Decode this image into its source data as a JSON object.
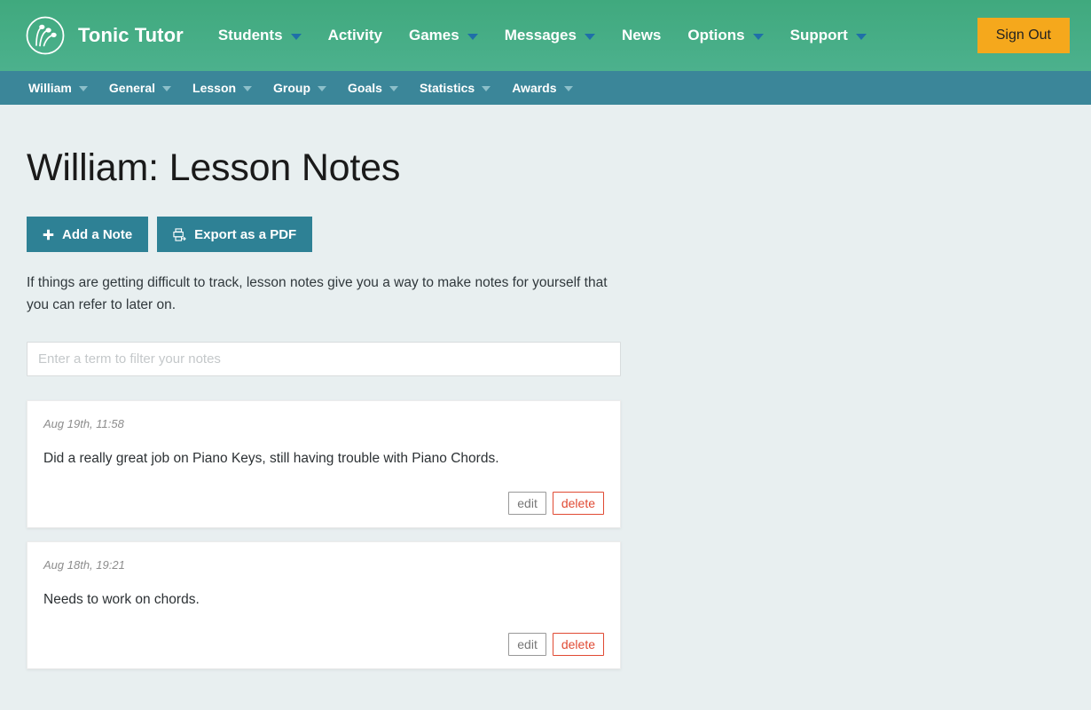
{
  "header": {
    "brand_name": "Tonic Tutor",
    "logo_icon": "tonic-tutor-music-logo",
    "nav": [
      {
        "label": "Students",
        "has_caret": true
      },
      {
        "label": "Activity",
        "has_caret": false
      },
      {
        "label": "Games",
        "has_caret": true
      },
      {
        "label": "Messages",
        "has_caret": true
      },
      {
        "label": "News",
        "has_caret": false
      },
      {
        "label": "Options",
        "has_caret": true
      },
      {
        "label": "Support",
        "has_caret": true
      }
    ],
    "sign_out_label": "Sign Out",
    "colors": {
      "header_gradient_top": "#40a97e",
      "header_gradient_bottom": "#4cb18d",
      "sign_out_bg": "#f5a81c",
      "caret": "#1f6fa8"
    }
  },
  "subnav": {
    "items": [
      {
        "label": "William",
        "has_caret": true
      },
      {
        "label": "General",
        "has_caret": true
      },
      {
        "label": "Lesson",
        "has_caret": true
      },
      {
        "label": "Group",
        "has_caret": true
      },
      {
        "label": "Goals",
        "has_caret": true
      },
      {
        "label": "Statistics",
        "has_caret": true
      },
      {
        "label": "Awards",
        "has_caret": true
      }
    ],
    "colors": {
      "bg": "#3b8699",
      "caret": "#8cbfca"
    }
  },
  "main": {
    "page_title": "William: Lesson Notes",
    "actions": [
      {
        "label": "Add a Note",
        "icon": "plus-icon",
        "glyph": "✚"
      },
      {
        "label": "Export as a PDF",
        "icon": "print-icon",
        "glyph": "⎙"
      }
    ],
    "intro_text": "If things are getting difficult to track, lesson notes give you a way to make notes for yourself that you can refer to later on.",
    "filter_placeholder": "Enter a term to filter your notes",
    "filter_value": "",
    "note_actions": {
      "edit_label": "edit",
      "delete_label": "delete"
    },
    "notes": [
      {
        "date": "Aug 19th, 11:58",
        "body": "Did a really great job on Piano Keys, still having trouble with Piano Chords."
      },
      {
        "date": "Aug 18th, 19:21",
        "body": "Needs to work on chords."
      }
    ],
    "colors": {
      "page_bg": "#e8eff0",
      "button_teal": "#2e8195",
      "delete_red": "#e04a33"
    }
  }
}
